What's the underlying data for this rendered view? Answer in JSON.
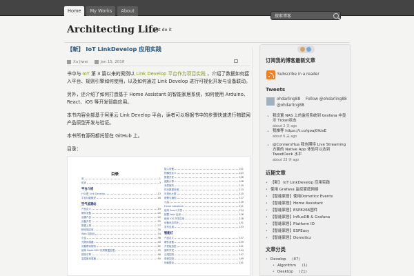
{
  "nav": {
    "items": [
      "Home",
      "My Works",
      "About"
    ],
    "search_placeholder": "搜索博客"
  },
  "site": {
    "title": "Architecting Life",
    "tagline": "Just do it"
  },
  "post": {
    "title": "【新】 IoT LinkDevelop 应用实践",
    "author": "Xu Jiwei",
    "date": "Jan 15, 2018",
    "paragraphs": [
      {
        "lead": "书中与",
        "link": "IoT",
        "mid": "第 3 篇以来的案例以",
        "link2": "Link Develop 平台作为项目实践",
        "rest": "，介绍了数据如何接入平台、规则引擎如何使用，以及如何通过 Link Develop 进行可视化开发与设备联动。"
      },
      {
        "text": "另外，还介绍了如何打造基于 Home Assistant 的智能家居系统，如何使用 Arduino、React、iOS 等开发智能应用。"
      },
      {
        "text": "本书内容全部基于阿里云 Link Develop 平台，读者可以根据书中的步骤快速进行物联网产品原型开发与验证。"
      },
      {
        "text": "本书所有源码都托管在 GitHub 上。"
      },
      {
        "text": "目录："
      }
    ],
    "toc": {
      "title": "目录",
      "left": [
        {
          "text": "序",
          "page": "1"
        },
        {
          "text": "前言",
          "page": "3"
        },
        {
          "heading": "平台介绍"
        },
        {
          "text": "什么是 Link Develop",
          "page": "13"
        },
        {
          "text": "平台功能概述",
          "page": "16"
        },
        {
          "heading": "空气监测站"
        },
        {
          "text": "产品定义",
          "page": "19"
        },
        {
          "text": "硬件准备",
          "page": "20"
        },
        {
          "text": "创建产品",
          "page": "22"
        },
        {
          "text": "设备开发",
          "page": "25"
        },
        {
          "text": "数据上报",
          "page": "27"
        },
        {
          "text": "移动端应用",
          "page": "30"
        },
        {
          "text": "Web 控制台",
          "page": "34"
        },
        {
          "text": "小结",
          "page": "38"
        },
        {
          "text": "光照传感器",
          "page": "40"
        },
        {
          "text": "设备联动规则",
          "page": "42"
        },
        {
          "text": "使用 Node-RED 实现数据处理",
          "page": "45"
        },
        {
          "text": "规则引擎",
          "page": "48"
        },
        {
          "text": "温湿度传感器",
          "page": "50"
        }
      ],
      "right": [
        {
          "text": "接入设备",
          "page": "101"
        },
        {
          "text": "物模型定义",
          "page": "103"
        },
        {
          "text": "数据开发",
          "page": "106"
        },
        {
          "text": "函数计算",
          "page": "108"
        },
        {
          "text": "消息服务",
          "page": "110"
        },
        {
          "text": "时序数据存储",
          "page": "113"
        },
        {
          "text": "可视化大屏",
          "page": "115"
        },
        {
          "text": "报警与通知",
          "page": "117"
        },
        {
          "text": "小结",
          "page": "119"
        },
        {
          "text": "Home Assistant",
          "page": "121"
        },
        {
          "text": "使用 React 开发",
          "page": "124"
        },
        {
          "text": "配置 Web 应用",
          "page": "126"
        },
        {
          "text": "使用 iOS 开发应用",
          "page": "128"
        },
        {
          "text": "设备状态同步",
          "page": "131"
        },
        {
          "text": "发布应用",
          "page": "133"
        },
        {
          "heading": "智能灯"
        },
        {
          "text": "产品定义",
          "page": "137"
        },
        {
          "text": "硬件准备",
          "page": "139"
        },
        {
          "text": "开发板选型",
          "page": "141"
        },
        {
          "text": "固件开发",
          "page": "144"
        },
        {
          "text": "云端控制",
          "page": "147"
        },
        {
          "text": "语音控制",
          "page": "149"
        },
        {
          "text": "场景联动",
          "page": "151"
        }
      ]
    }
  },
  "sidebar": {
    "subscribe_title": "订阅我的博客最新文章",
    "subscribe_label": "Subscribe in a reader",
    "tweets_title": "Tweets",
    "twitter_user": "ohdarling88",
    "twitter_handle": "@ohdarling88",
    "follow_label": "Follow @ohdarling88",
    "tweets": [
      {
        "text": "我设置 NAS 上的监控系统到 Grafana 中显示 Ticket状态",
        "time": "about 2 天 ago"
      },
      {
        "text": "我推荐 https://t.co/goaj0lkisE",
        "time": "about 6 天 ago"
      },
      {
        "text": "@ConnersHua 我也期待 Live Streaming 方面的 Native App 体验可以达到 TweetDeck 水平",
        "time": "about 23 天 ago"
      }
    ],
    "recent_title": "近期文章",
    "recent_posts": [
      "【新】 IoT LinkDevelop 应用实践",
      "使用 Grafana 监控家庭网络",
      "【智能家居】使用Domoticz Events",
      "【智能家居】Home Assistant",
      "【智能家居】ESP8266固件",
      "【智能家居】InfluxDB & Grafana",
      "【智能家居】Platform IO",
      "【智能家居】ESPEasy",
      "【智能家居】Domoticz"
    ],
    "categories_title": "文章分类",
    "categories": [
      {
        "name": "Develop",
        "count": "(87)"
      },
      {
        "name": "Algorithm",
        "count": "(1)"
      },
      {
        "name": "Desktop",
        "count": "(21)"
      }
    ]
  }
}
